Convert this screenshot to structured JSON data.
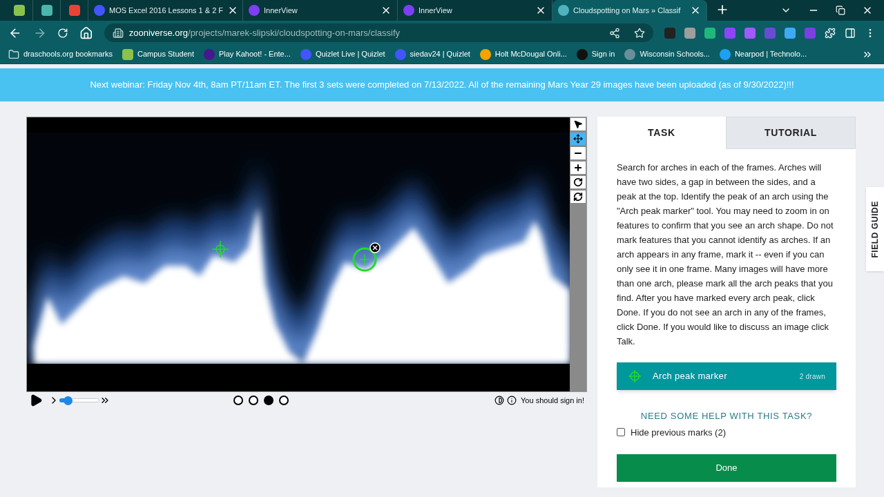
{
  "browser": {
    "tabs": [
      {
        "kind": "pinned",
        "color": "#8bc34a",
        "selected": false
      },
      {
        "kind": "pinned",
        "color": "#4db6ac",
        "selected": false
      },
      {
        "kind": "pinned",
        "color": "#ea4335",
        "selected": false
      },
      {
        "kind": "page",
        "color": "#4255ff",
        "title": "MOS Excel 2016 Lessons 1 & 2 F",
        "selected": false
      },
      {
        "kind": "page",
        "color": "#7e3ff2",
        "title": "InnerView",
        "selected": false
      },
      {
        "kind": "page",
        "color": "#7e3ff2",
        "title": "InnerView",
        "selected": false
      },
      {
        "kind": "page",
        "color": "#4fb3bf",
        "title": "Cloudspotting on Mars » Classif",
        "selected": true
      }
    ],
    "address": {
      "host": "zooniverse.org",
      "path": "/projects/marek-slipski/cloudspotting-on-mars/classify"
    },
    "extensions": [
      {
        "color": "#222222"
      },
      {
        "color": "#9e9e9e"
      },
      {
        "color": "#1fb87a"
      },
      {
        "color": "#8e44ff"
      },
      {
        "color": "#a259ff"
      },
      {
        "color": "#6c4ad6"
      },
      {
        "color": "#3fa9f5"
      },
      {
        "color": "#7b3fe4"
      }
    ],
    "bookmarks": [
      {
        "title": "draschools.org bookmarks",
        "color": "#cfd8dc"
      },
      {
        "title": "Campus Student",
        "color": "#8bc34a"
      },
      {
        "title": "Play Kahoot! - Ente...",
        "color": "#46178f"
      },
      {
        "title": "Quizlet Live | Quizlet",
        "color": "#4255ff"
      },
      {
        "title": "siedav24 | Quizlet",
        "color": "#4255ff"
      },
      {
        "title": "Holt McDougal Onli...",
        "color": "#f4a300"
      },
      {
        "title": "Sign in",
        "color": "#111111"
      },
      {
        "title": "Wisconsin Schools...",
        "color": "#6b8e9b"
      },
      {
        "title": "Nearpod | Technolo...",
        "color": "#1da1f2"
      }
    ]
  },
  "banner": "Next webinar: Friday Nov 4th, 8am PT/11am ET. The first 3 sets were completed on 7/13/2022. All of the remaining Mars Year 29 images have been uploaded (as of 9/30/2022)!!!",
  "viewer": {
    "tools": [
      {
        "kind": "pointer",
        "selected": false
      },
      {
        "kind": "move",
        "selected": true
      },
      {
        "kind": "zoom-out",
        "selected": false
      },
      {
        "kind": "zoom-in",
        "selected": false
      },
      {
        "kind": "rotate",
        "selected": false
      },
      {
        "kind": "reset",
        "selected": false
      }
    ],
    "marks": [
      {
        "selected": false
      },
      {
        "selected": true
      }
    ],
    "playback": {
      "level": 0.2
    },
    "frames": [
      {
        "selected": false
      },
      {
        "selected": false
      },
      {
        "selected": true
      },
      {
        "selected": false
      }
    ],
    "sign_in": "You should sign in!"
  },
  "panel": {
    "tabs": [
      {
        "label": "TASK",
        "selected": true
      },
      {
        "label": "TUTORIAL",
        "selected": false
      }
    ],
    "instructions": "Search for arches in each of the frames. Arches will have two sides, a gap in between the sides, and a peak at the top. Identify the peak of an arch using the \"Arch peak marker\" tool. You may need to zoom in on features to confirm that you see an arch shape. Do not mark features that you cannot identify as arches. If an arch appears in any frame, mark it -- even if you can only see it in one frame. Many images will have more than one arch, please mark all the arch peaks that you find. After you have marked every arch peak, click Done. If you do not see an arch in any of the frames, click Done. If you would like to discuss an image click Talk.",
    "tool": {
      "label": "Arch peak marker",
      "count": "2 drawn",
      "selected": true
    },
    "help": "NEED SOME HELP WITH THIS TASK?",
    "hide_marks": {
      "label": "Hide previous marks (2)",
      "checked": false
    },
    "done": "Done"
  },
  "field_guide": "FIELD GUIDE"
}
